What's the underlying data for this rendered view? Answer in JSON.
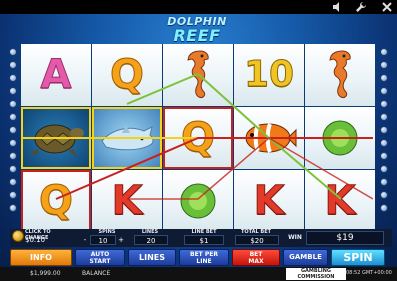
{
  "header": {
    "title_line1": "DOLPHIN",
    "title_line2": "REEF",
    "icons": [
      "speaker-icon",
      "wrench-icon",
      "close-icon"
    ]
  },
  "reels": {
    "symbols": [
      [
        "A",
        "Q",
        "seahorse",
        "10",
        "seahorse"
      ],
      [
        "turtle",
        "dolphin",
        "Q",
        "clownfish",
        "coral"
      ],
      [
        "Q",
        "K",
        "coral",
        "K",
        "K"
      ]
    ],
    "winning_cells_yellow": [
      [
        1,
        0
      ],
      [
        1,
        1
      ]
    ],
    "winning_cells_red": [
      [
        1,
        2
      ],
      [
        2,
        0
      ]
    ]
  },
  "controls": {
    "click_to_change": "CLICK TO CHANGE",
    "coin_value": "$0.10",
    "spins_label": "SPINS",
    "spins_value": "10",
    "lines_label": "LINES",
    "lines_value": "20",
    "line_bet_label": "LINE BET",
    "line_bet_value": "$1",
    "total_bet_label": "TOTAL BET",
    "total_bet_value": "$20",
    "win_label": "WIN",
    "win_value": "$19",
    "minus": "-",
    "plus": "+"
  },
  "buttons": {
    "info": "INFO",
    "auto_start_1": "AUTO",
    "auto_start_2": "START",
    "lines": "LINES",
    "bet_per_line_1": "BET PER",
    "bet_per_line_2": "LINE",
    "bet_max_1": "BET",
    "bet_max_2": "MAX",
    "gamble": "GAMBLE",
    "spin": "SPIN"
  },
  "footer": {
    "balance_value": "$1,999.00",
    "balance_label": "BALANCE",
    "commission_1": "GAMBLING",
    "commission_2": "COMMISSION",
    "time": "08:52 GMT+00:00"
  },
  "colors": {
    "yellow_line": "#f2d21a",
    "red_line": "#c8201a",
    "green_line": "#7cc23a"
  }
}
